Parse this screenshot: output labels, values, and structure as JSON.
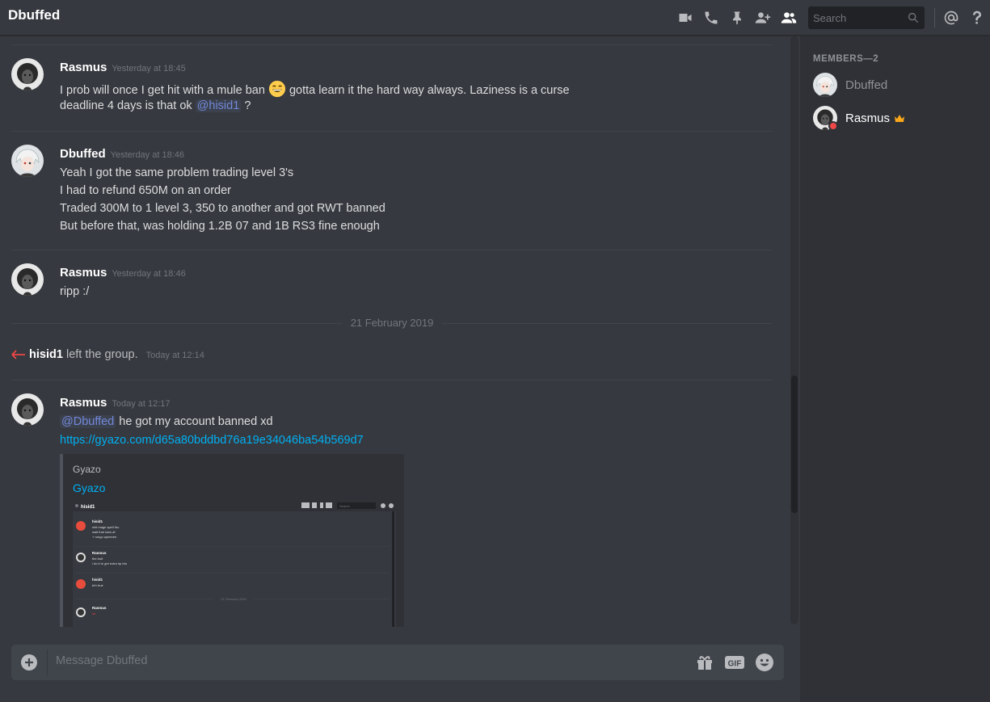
{
  "header": {
    "title": "Dbuffed",
    "search_placeholder": "Search",
    "icons": [
      "video-call-icon",
      "voice-call-icon",
      "pin-icon",
      "add-friend-icon",
      "member-list-icon",
      "mention-icon",
      "help-icon"
    ]
  },
  "messages": [
    {
      "author": "Rasmus",
      "timestamp": "Yesterday at 18:45",
      "lines": {
        "l1_before_emoji": "I prob will once I get hit with a mule ban",
        "l1_after_emoji": "gotta learn it the hard way always. Laziness is a curse",
        "l2_text": "deadline 4 days is that ok",
        "l2_mention": "@hisid1",
        "l2_end": "?"
      }
    },
    {
      "author": "Dbuffed",
      "timestamp": "Yesterday at 18:46",
      "lines": [
        "Yeah I got the same problem trading level 3's",
        "I had to refund 650M on an order",
        "Traded 300M to 1 level 3, 350 to another and got RWT banned",
        "But before that, was holding 1.2B 07 and 1B RS3 fine enough"
      ]
    },
    {
      "author": "Rasmus",
      "timestamp": "Yesterday at 18:46",
      "lines": [
        "ripp :/"
      ]
    },
    {
      "author": "Rasmus",
      "timestamp": "Today at 12:17",
      "mention": "@Dbuffed",
      "text": "he got my account banned xd",
      "link": "https://gyazo.com/d65a80bddbd76a19e34046ba54b569d7",
      "embed": {
        "provider": "Gyazo",
        "title": "Gyazo",
        "thumb": {
          "channel": "hisid1",
          "search": "Search",
          "rows": [
            {
              "author": "hisid1",
              "lines": [
                "wht mage spell tho",
                "wait that slow af",
                "+ rungo ayeeeee"
              ]
            },
            {
              "author": "Rasmus",
              "lines": [
                "fire bolt",
                "i do it to get extra hp lvls"
              ]
            },
            {
              "author": "hisid1",
              "lines": [
                "brh true"
              ]
            },
            {
              "author": "Rasmus",
              "lines": [
                "lol"
              ]
            }
          ],
          "date": "21 February 2019"
        }
      }
    }
  ],
  "date_divider": "21 February 2019",
  "system": {
    "user": "hisid1",
    "text": "left the group.",
    "timestamp": "Today at 12:14"
  },
  "composer": {
    "placeholder": "Message Dbuffed",
    "gif_label": "GIF"
  },
  "members": {
    "header": "MEMBERS—2",
    "list": [
      {
        "name": "Dbuffed",
        "status": "offline"
      },
      {
        "name": "Rasmus",
        "status": "dnd",
        "owner": true
      }
    ]
  },
  "colors": {
    "background": "#36393f",
    "sidebar": "#2f3136",
    "mention": "#7289da",
    "link": "#00b0f4",
    "dnd": "#f04747",
    "crown": "#faa61a"
  }
}
